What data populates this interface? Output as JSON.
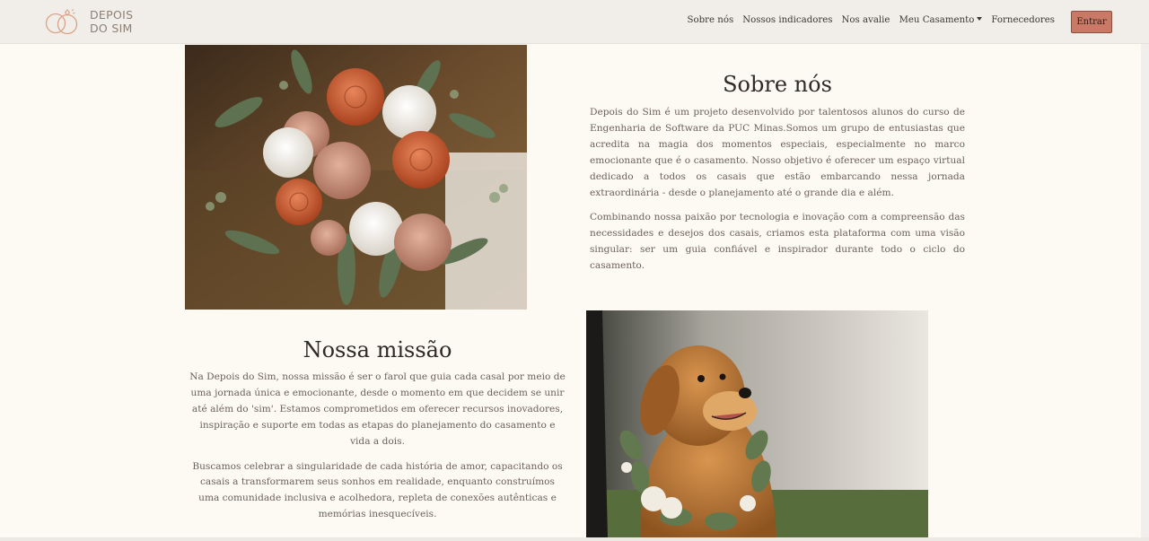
{
  "brand": {
    "line1": "DEPOIS",
    "line2": "DO SIM"
  },
  "nav": {
    "items": [
      {
        "label": "Sobre nós"
      },
      {
        "label": "Nossos indicadores"
      },
      {
        "label": "Nos avalie"
      },
      {
        "label": "Meu Casamento"
      },
      {
        "label": "Fornecedores"
      }
    ],
    "login_label": "Entrar"
  },
  "about": {
    "title": "Sobre nós",
    "paragraphs": [
      "Depois do Sim é um projeto desenvolvido por talentosos alunos do curso de Engenharia de Software da PUC Minas.Somos um grupo de entusiastas que acredita na magia dos momentos especiais, especialmente no marco emocionante que é o casamento. Nosso objetivo é oferecer um espaço virtual dedicado a todos os casais que estão embarcando nessa jornada extraordinária - desde o planejamento até o grande dia e além.",
      "Combinando nossa paixão por tecnologia e inovação com a compreensão das necessidades e desejos dos casais, criamos esta plataforma com uma visão singular: ser um guia confiável e inspirador durante todo o ciclo do casamento."
    ]
  },
  "mission": {
    "title": "Nossa missão",
    "paragraphs": [
      "Na Depois do Sim, nossa missão é ser o farol que guia cada casal por meio de uma jornada única e emocionante, desde o momento em que decidem se unir até além do 'sim'. Estamos comprometidos em oferecer recursos inovadores, inspiração e suporte em todas as etapas do planejamento do casamento e vida a dois.",
      "Buscamos celebrar a singularidade de cada história de amor, capacitando os casais a transformarem seus sonhos em realidade, enquanto construímos uma comunidade inclusiva e acolhedora, repleta de conexões autênticas e memórias inesquecíveis."
    ]
  },
  "colors": {
    "background": "#fdf9f3",
    "navbar": "#f1eeea",
    "accent_button": "#c97966",
    "logo": "#d9a185"
  },
  "icons": {
    "logo": "rings-icon",
    "dropdown": "caret-down-icon"
  }
}
